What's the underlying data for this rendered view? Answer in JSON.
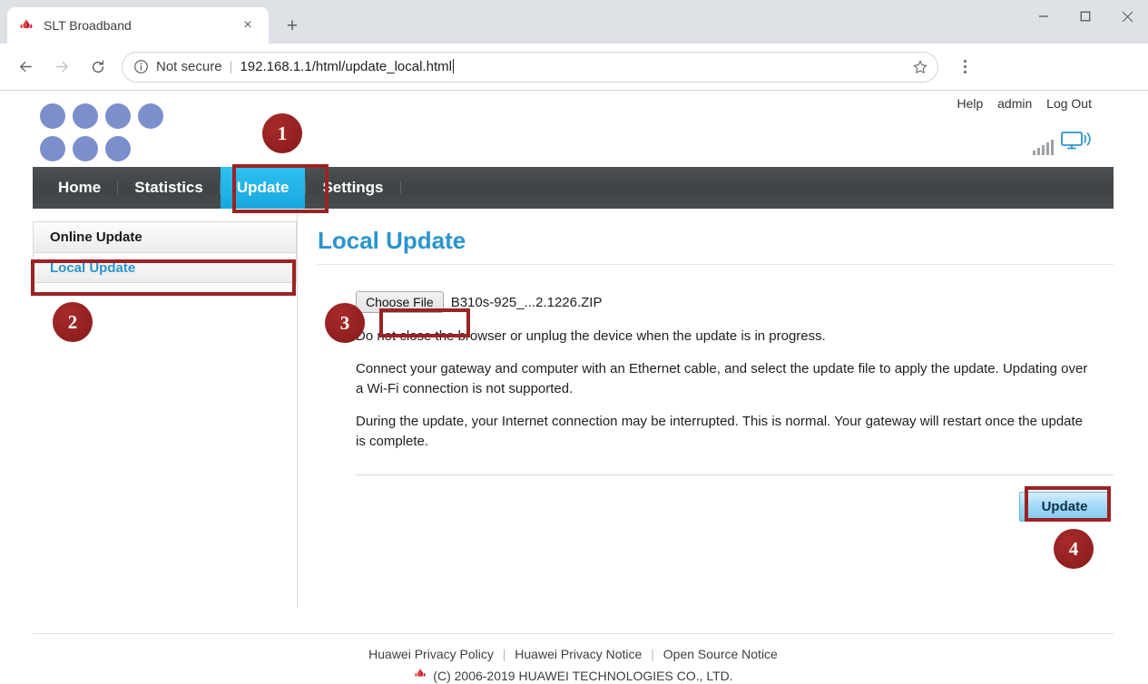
{
  "browser": {
    "tab": {
      "title": "SLT Broadband",
      "favicon": "huawei-flower-icon",
      "close": "×"
    },
    "new_tab_label": "+",
    "window_controls": {
      "minimize": "—",
      "maximize": "□",
      "close": "✕"
    },
    "back_label": "←",
    "forward_label": "→",
    "reload_label": "↻",
    "security_label": "Not secure",
    "url": "192.168.1.1/html/update_local.html",
    "bookmark_icon": "star-icon",
    "menu_icon": "three-dot-menu-icon"
  },
  "header": {
    "logo": "seven-dot-logo",
    "logo_color": "#7b8fcc",
    "links": [
      {
        "label": "Help"
      },
      {
        "label": "admin"
      },
      {
        "label": "Log Out"
      }
    ],
    "signal_icon": "signal-bars-icon",
    "device_icon": "monitor-wifi-icon"
  },
  "nav": {
    "items": [
      {
        "label": "Home",
        "active": false
      },
      {
        "label": "Statistics",
        "active": false
      },
      {
        "label": "Update",
        "active": true
      },
      {
        "label": "Settings",
        "active": false
      }
    ],
    "active_color": "#1ca8e0",
    "bar_color": "#43494b"
  },
  "sidebar": {
    "items": [
      {
        "label": "Online Update",
        "selected": false
      },
      {
        "label": "Local Update",
        "selected": true
      }
    ]
  },
  "main": {
    "title": "Local Update",
    "title_color": "#2a94cf",
    "choose_file_label": "Choose File",
    "file_name": "B310s-925_...2.1226.ZIP",
    "paragraphs": [
      "Do not close the browser or unplug the device when the update is in progress.",
      "Connect your gateway and computer with an Ethernet cable, and select the update file to apply the update. Updating over a Wi-Fi connection is not supported.",
      "During the update, your Internet connection may be interrupted. This is normal. Your gateway will restart once the update is complete."
    ],
    "update_button_label": "Update"
  },
  "footer": {
    "links": [
      {
        "label": "Huawei Privacy Policy"
      },
      {
        "label": "Huawei Privacy Notice"
      },
      {
        "label": "Open Source Notice"
      }
    ],
    "separator": "|",
    "copyright": "(C) 2006-2019 HUAWEI TECHNOLOGIES CO., LTD.",
    "copyright_icon": "huawei-flower-icon"
  },
  "annotations": {
    "accent_color": "#9b2323",
    "steps": [
      {
        "number": "1",
        "target": "nav-update-tab"
      },
      {
        "number": "2",
        "target": "sidebar-local-update"
      },
      {
        "number": "3",
        "target": "choose-file-button"
      },
      {
        "number": "4",
        "target": "update-button"
      }
    ]
  }
}
